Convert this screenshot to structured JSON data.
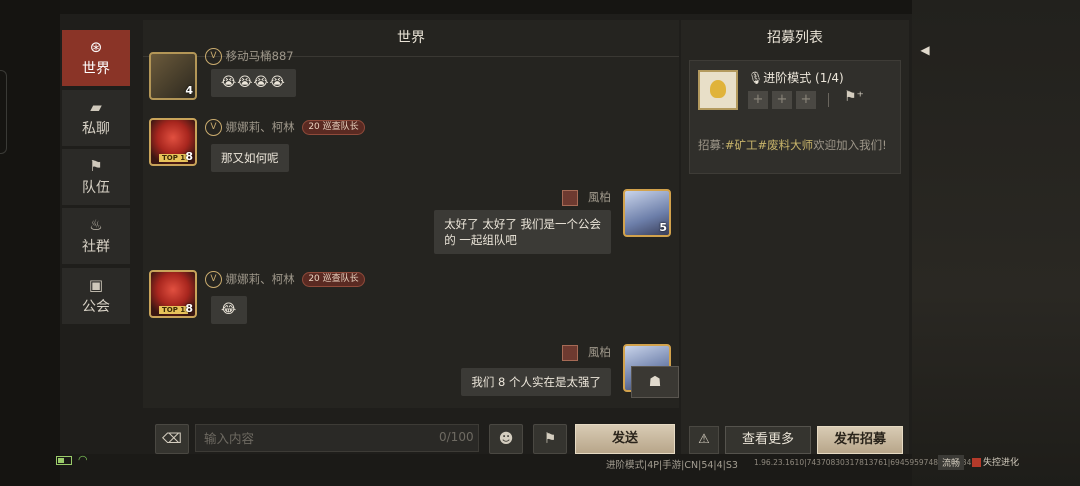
{
  "nav": {
    "items": [
      {
        "label": "世界",
        "icon": "globe-icon",
        "glyph": "⊛",
        "active": true
      },
      {
        "label": "私聊",
        "icon": "chat-bubble-icon",
        "glyph": "▰",
        "active": false
      },
      {
        "label": "队伍",
        "icon": "flag-icon",
        "glyph": "⚑",
        "active": false
      },
      {
        "label": "社群",
        "icon": "campfire-icon",
        "glyph": "♨",
        "active": false
      },
      {
        "label": "公会",
        "icon": "guild-icon",
        "glyph": "▣",
        "active": false
      }
    ]
  },
  "chat": {
    "title": "世界",
    "messages": [
      {
        "name": "移动马桶887",
        "text": "😭😭😭😭",
        "avatar_level": "4",
        "side": "left"
      },
      {
        "name": "娜娜莉、柯林",
        "tag": "20  巡查队长",
        "text": "那又如何呢",
        "avatar_level": "8",
        "avatar_top": "TOP 1",
        "side": "left"
      },
      {
        "name": "風柏",
        "text_line1": "太好了 太好了 我们是一个公会",
        "text_line2": "的 一起组队吧",
        "avatar_level": "5",
        "side": "right"
      },
      {
        "name": "娜娜莉、柯林",
        "tag": "20  巡查队长",
        "text": "😂",
        "avatar_level": "8",
        "avatar_top": "TOP 1",
        "side": "left"
      },
      {
        "name": "風柏",
        "text": "我们 8 个人实在是太强了",
        "side": "right"
      }
    ],
    "input_placeholder": "输入内容",
    "counter": "0/100",
    "send_label": "发送"
  },
  "recruit": {
    "title": "招募列表",
    "card": {
      "mode": "进阶模式 (1/4)",
      "slots": [
        "+",
        "+",
        "+"
      ],
      "text_prefix": "招募:",
      "highlight": "#矿工#废料大师",
      "text_suffix": "欢迎加入我们!"
    },
    "more_label": "查看更多",
    "publish_label": "发布招募"
  },
  "status": {
    "mode": "进阶模式|4P|手游|CN|54|4|S3",
    "version": "1.96.23.1610|74370830317813761|69459597489733634",
    "flow": "流畅",
    "brand": "失控进化"
  },
  "colors": {
    "accent_active": "#8a3427",
    "button_light": "#c9b99e",
    "highlight_text": "#c8b46a"
  }
}
